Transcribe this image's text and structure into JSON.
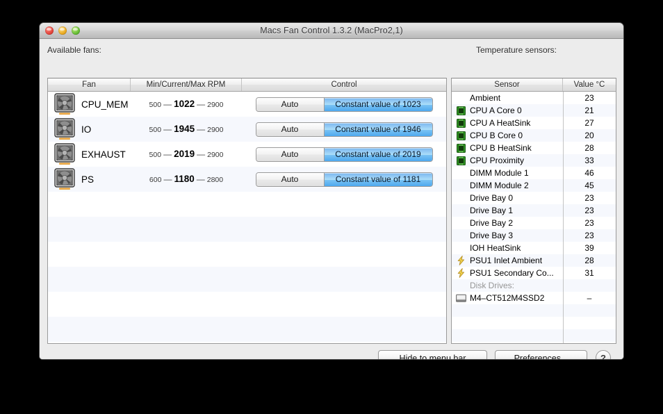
{
  "window": {
    "title": "Macs Fan Control 1.3.2 (MacPro2,1)",
    "traffic_lights": {
      "close": "close-button",
      "minimize": "minimize-button",
      "zoom": "zoom-button"
    }
  },
  "fans_panel": {
    "label": "Available fans:",
    "columns": [
      "Fan",
      "Min/Current/Max RPM",
      "Control"
    ],
    "rows": [
      {
        "icon": "fan-icon",
        "name": "CPU_MEM",
        "min": "500",
        "current": "1022",
        "max": "2900",
        "dash": "—",
        "auto_label": "Auto",
        "constant_label": "Constant value of 1023",
        "mode": "constant"
      },
      {
        "icon": "fan-icon",
        "name": "IO",
        "min": "500",
        "current": "1945",
        "max": "2900",
        "dash": "—",
        "auto_label": "Auto",
        "constant_label": "Constant value of 1946",
        "mode": "constant"
      },
      {
        "icon": "fan-icon",
        "name": "EXHAUST",
        "min": "500",
        "current": "2019",
        "max": "2900",
        "dash": "—",
        "auto_label": "Auto",
        "constant_label": "Constant value of 2019",
        "mode": "constant"
      },
      {
        "icon": "fan-icon",
        "name": "PS",
        "min": "600",
        "current": "1180",
        "max": "2800",
        "dash": "—",
        "auto_label": "Auto",
        "constant_label": "Constant value of 1181",
        "mode": "constant"
      }
    ],
    "empty_row_count": 6
  },
  "sensors_panel": {
    "label": "Temperature sensors:",
    "columns": [
      "Sensor",
      "Value °C"
    ],
    "rows": [
      {
        "icon": "none",
        "name": "Ambient",
        "value": "23"
      },
      {
        "icon": "chip-icon",
        "name": "CPU A Core 0",
        "value": "21"
      },
      {
        "icon": "chip-icon",
        "name": "CPU A HeatSink",
        "value": "27"
      },
      {
        "icon": "chip-icon",
        "name": "CPU B Core 0",
        "value": "20"
      },
      {
        "icon": "chip-icon",
        "name": "CPU B HeatSink",
        "value": "28"
      },
      {
        "icon": "chip-icon",
        "name": "CPU Proximity",
        "value": "33"
      },
      {
        "icon": "none",
        "name": "DIMM Module 1",
        "value": "46"
      },
      {
        "icon": "none",
        "name": "DIMM Module 2",
        "value": "45"
      },
      {
        "icon": "none",
        "name": "Drive Bay 0",
        "value": "23"
      },
      {
        "icon": "none",
        "name": "Drive Bay 1",
        "value": "23"
      },
      {
        "icon": "none",
        "name": "Drive Bay 2",
        "value": "23"
      },
      {
        "icon": "none",
        "name": "Drive Bay 3",
        "value": "23"
      },
      {
        "icon": "none",
        "name": "IOH HeatSink",
        "value": "39"
      },
      {
        "icon": "bolt-icon",
        "name": "PSU1 Inlet Ambient",
        "value": "28"
      },
      {
        "icon": "bolt-icon",
        "name": "PSU1 Secondary Co...",
        "value": "31"
      },
      {
        "icon": "none",
        "name": "Disk Drives:",
        "value": "",
        "group": true
      },
      {
        "icon": "disk-icon",
        "name": "M4–CT512M4SSD2",
        "value": "–"
      }
    ],
    "empty_row_count": 4
  },
  "footer": {
    "hide_label": "Hide to menu bar",
    "prefs_label": "Preferences...",
    "help_label": "?"
  },
  "colors": {
    "accent_blue": "#4ea8ef",
    "window_chrome": "#ececec",
    "stripe": "#f6f8fd",
    "chip_green": "#2f8f23",
    "bolt_yellow": "#e8c73a",
    "group_text": "#959595"
  }
}
